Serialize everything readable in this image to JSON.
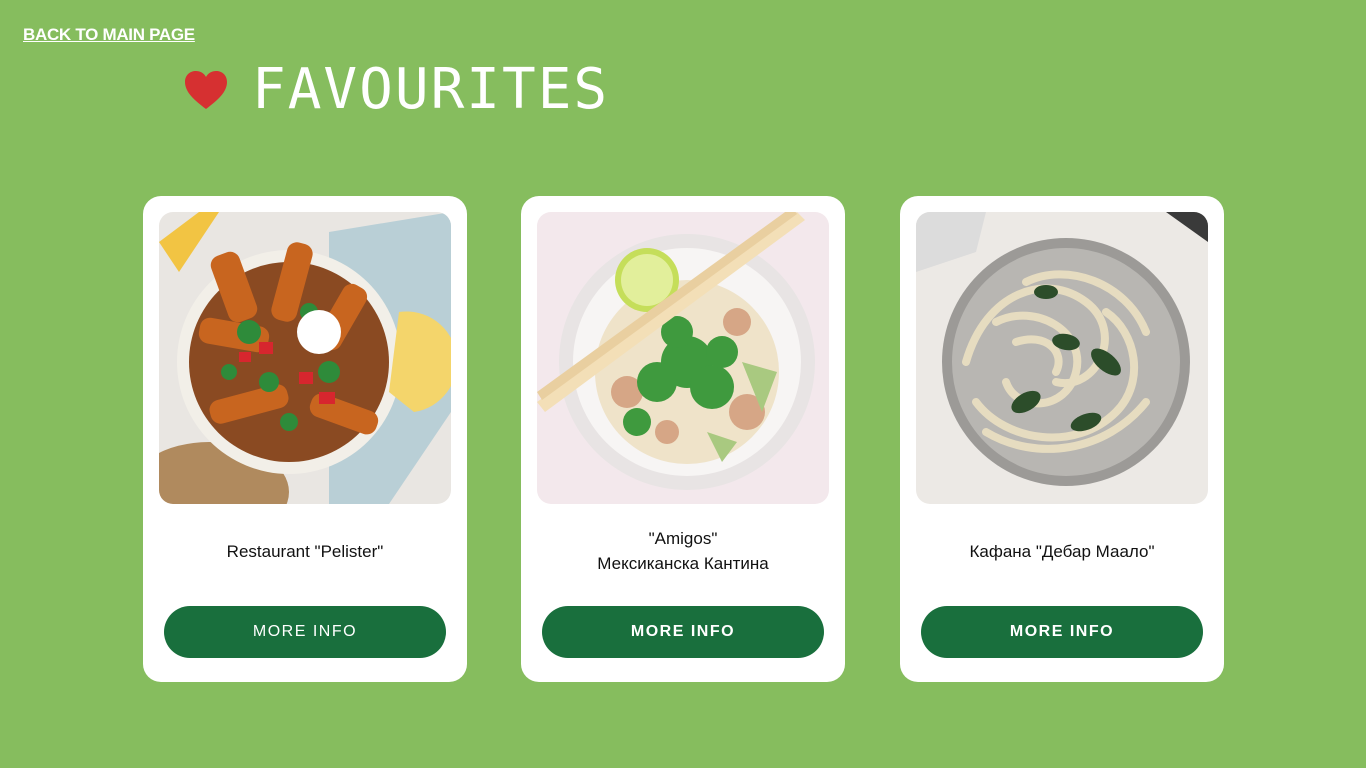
{
  "nav": {
    "back_label": "BACK TO MAIN PAGE"
  },
  "header": {
    "title": "FAVOURITES",
    "icon": "heart-icon",
    "icon_color": "#d63031"
  },
  "colors": {
    "background": "#86bd5e",
    "button": "#196f3d",
    "card": "#ffffff"
  },
  "cards": [
    {
      "name_line1": "Restaurant \"Pelister\"",
      "name_line2": "",
      "button_label": "MORE INFO",
      "image": "fries-bowl-image"
    },
    {
      "name_line1": "\"Amigos\"",
      "name_line2": "Мексиканска Кантина",
      "button_label": "MORE INFO",
      "image": "rice-bowl-image"
    },
    {
      "name_line1": "Кафана \"Дебар Маало\"",
      "name_line2": "",
      "button_label": "MORE INFO",
      "image": "pasta-bowl-image"
    }
  ]
}
